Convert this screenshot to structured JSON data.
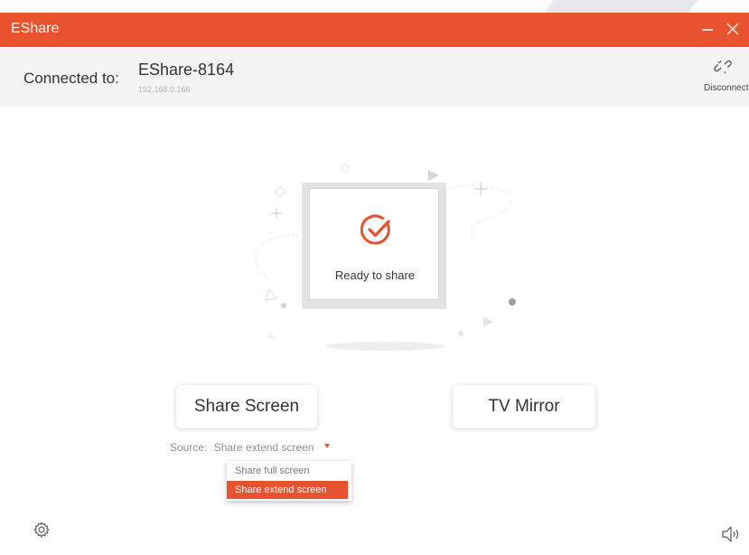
{
  "window": {
    "title": "EShare",
    "accent_color": "#e8522e",
    "minimize_icon": "minimize-icon",
    "close_icon": "close-icon"
  },
  "connection": {
    "label": "Connected to:",
    "device_name": "EShare-8164",
    "ip_address": "192.168.0.166",
    "disconnect_label": "Disconnect",
    "disconnect_icon": "unlink-icon"
  },
  "status": {
    "text": "Ready to share",
    "icon": "check-circle-icon"
  },
  "actions": {
    "share_screen_label": "Share Screen",
    "tv_mirror_label": "TV Mirror"
  },
  "source": {
    "label": "Source:",
    "selected": "Share extend screen",
    "options": [
      {
        "label": "Share full screen",
        "selected": false
      },
      {
        "label": "Share extend screen",
        "selected": true
      }
    ]
  },
  "footer": {
    "settings_icon": "gear-icon",
    "sound_icon": "speaker-icon"
  }
}
